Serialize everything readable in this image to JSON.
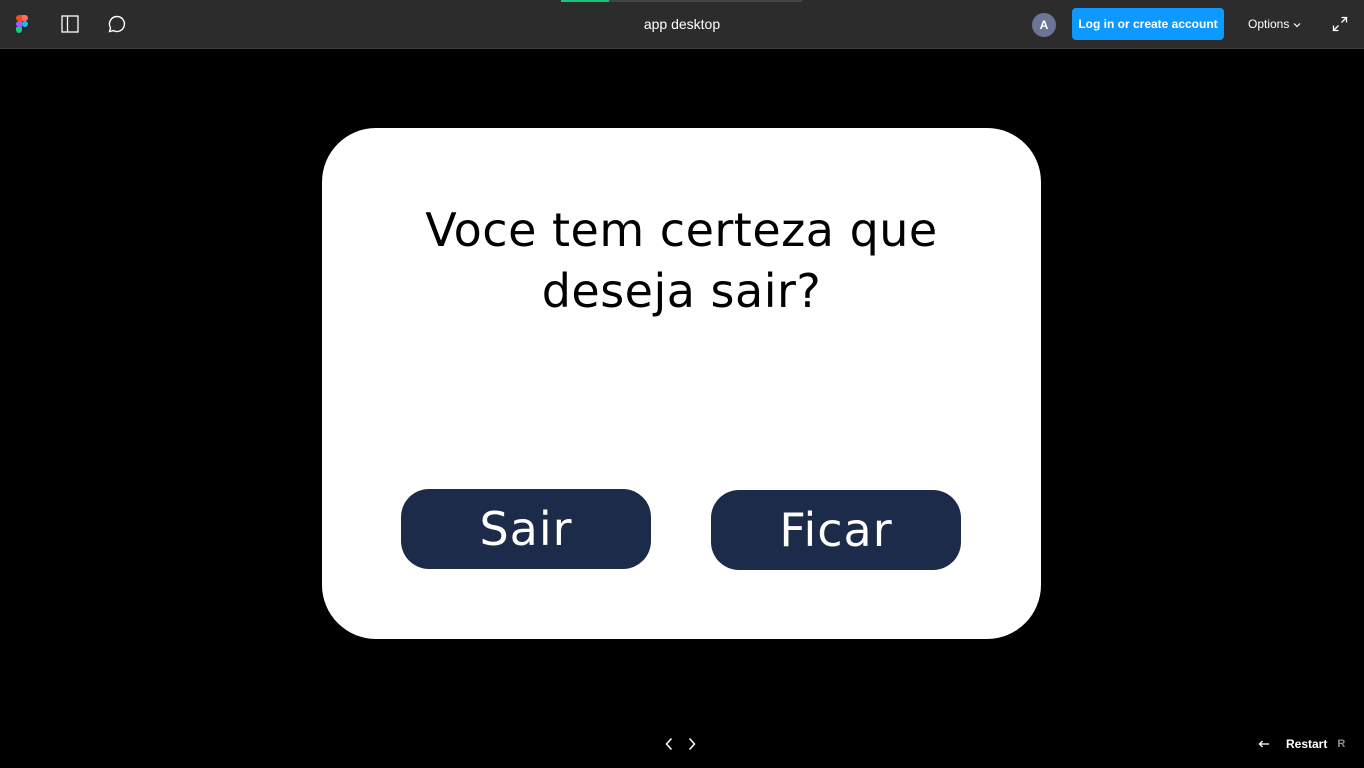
{
  "toolbar": {
    "title": "app desktop",
    "avatar_initial": "A",
    "login_label": "Log in or create account",
    "options_label": "Options",
    "progress": 0.2,
    "icons": [
      "figma-logo-icon",
      "sidebar-toggle-icon",
      "comment-icon",
      "chevron-down-icon",
      "expand-icon"
    ]
  },
  "dialog": {
    "question_line1": "Voce tem certeza que",
    "question_line2": "deseja sair?",
    "leave_label": "Sair",
    "stay_label": "Ficar"
  },
  "footer": {
    "restart_label": "Restart",
    "restart_shortcut": "R",
    "icons": [
      "previous-arrow-icon",
      "next-arrow-icon",
      "restart-arrow-icon"
    ]
  },
  "colors": {
    "toolbar_bg": "#2c2c2c",
    "canvas_bg": "#000000",
    "accent_blue": "#0d99ff",
    "progress_green": "#1bc47d",
    "button_navy": "#1b2b49",
    "avatar_bg": "#6a7597"
  }
}
